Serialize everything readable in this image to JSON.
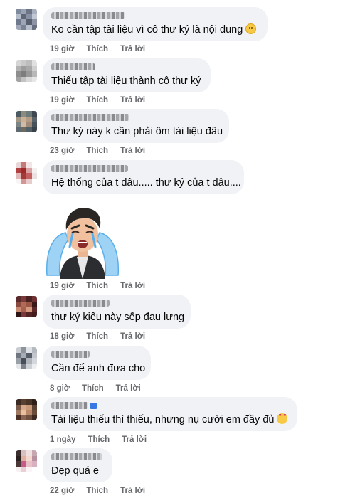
{
  "comments": [
    {
      "text": "Ko cần tập tài liệu vì cô thư ký là nội dung",
      "emoji": "smile",
      "time": "19 giờ",
      "like": "Thích",
      "reply": "Trả lời"
    },
    {
      "text": "Thiếu tập tài liệu thành cô thư ký",
      "time": "19 giờ",
      "like": "Thích",
      "reply": "Trả lời"
    },
    {
      "text": "Thư ký này k cần phải ôm tài liệu đâu",
      "time": "23 giờ",
      "like": "Thích",
      "reply": "Trả lời"
    },
    {
      "text": "Hệ thống của t đâu..... thư ký của t đâu....",
      "time": "",
      "like": "",
      "reply": ""
    },
    {
      "text": "",
      "sticker": "crying-man-sticker",
      "time": "19 giờ",
      "like": "Thích",
      "reply": "Trả lời"
    },
    {
      "text": "thư ký kiểu này sếp đau lưng",
      "time": "18 giờ",
      "like": "Thích",
      "reply": "Trả lời"
    },
    {
      "text": "Cần để anh đưa cho",
      "time": "8 giờ",
      "like": "Thích",
      "reply": "Trả lời"
    },
    {
      "text": "Tài liệu thiếu thì thiếu, nhưng nụ cười em đầy đủ",
      "emoji": "heart-eyes",
      "verified": true,
      "time": "1 ngày",
      "like": "Thích",
      "reply": "Trả lời"
    },
    {
      "text": "Đẹp quá e",
      "time": "22 giờ",
      "like": "Thích",
      "reply": "Trả lời"
    }
  ],
  "colors": {
    "bubble": "#f0f2f5",
    "meta": "#65676b",
    "text": "#050505",
    "verified": "#3578e5"
  }
}
